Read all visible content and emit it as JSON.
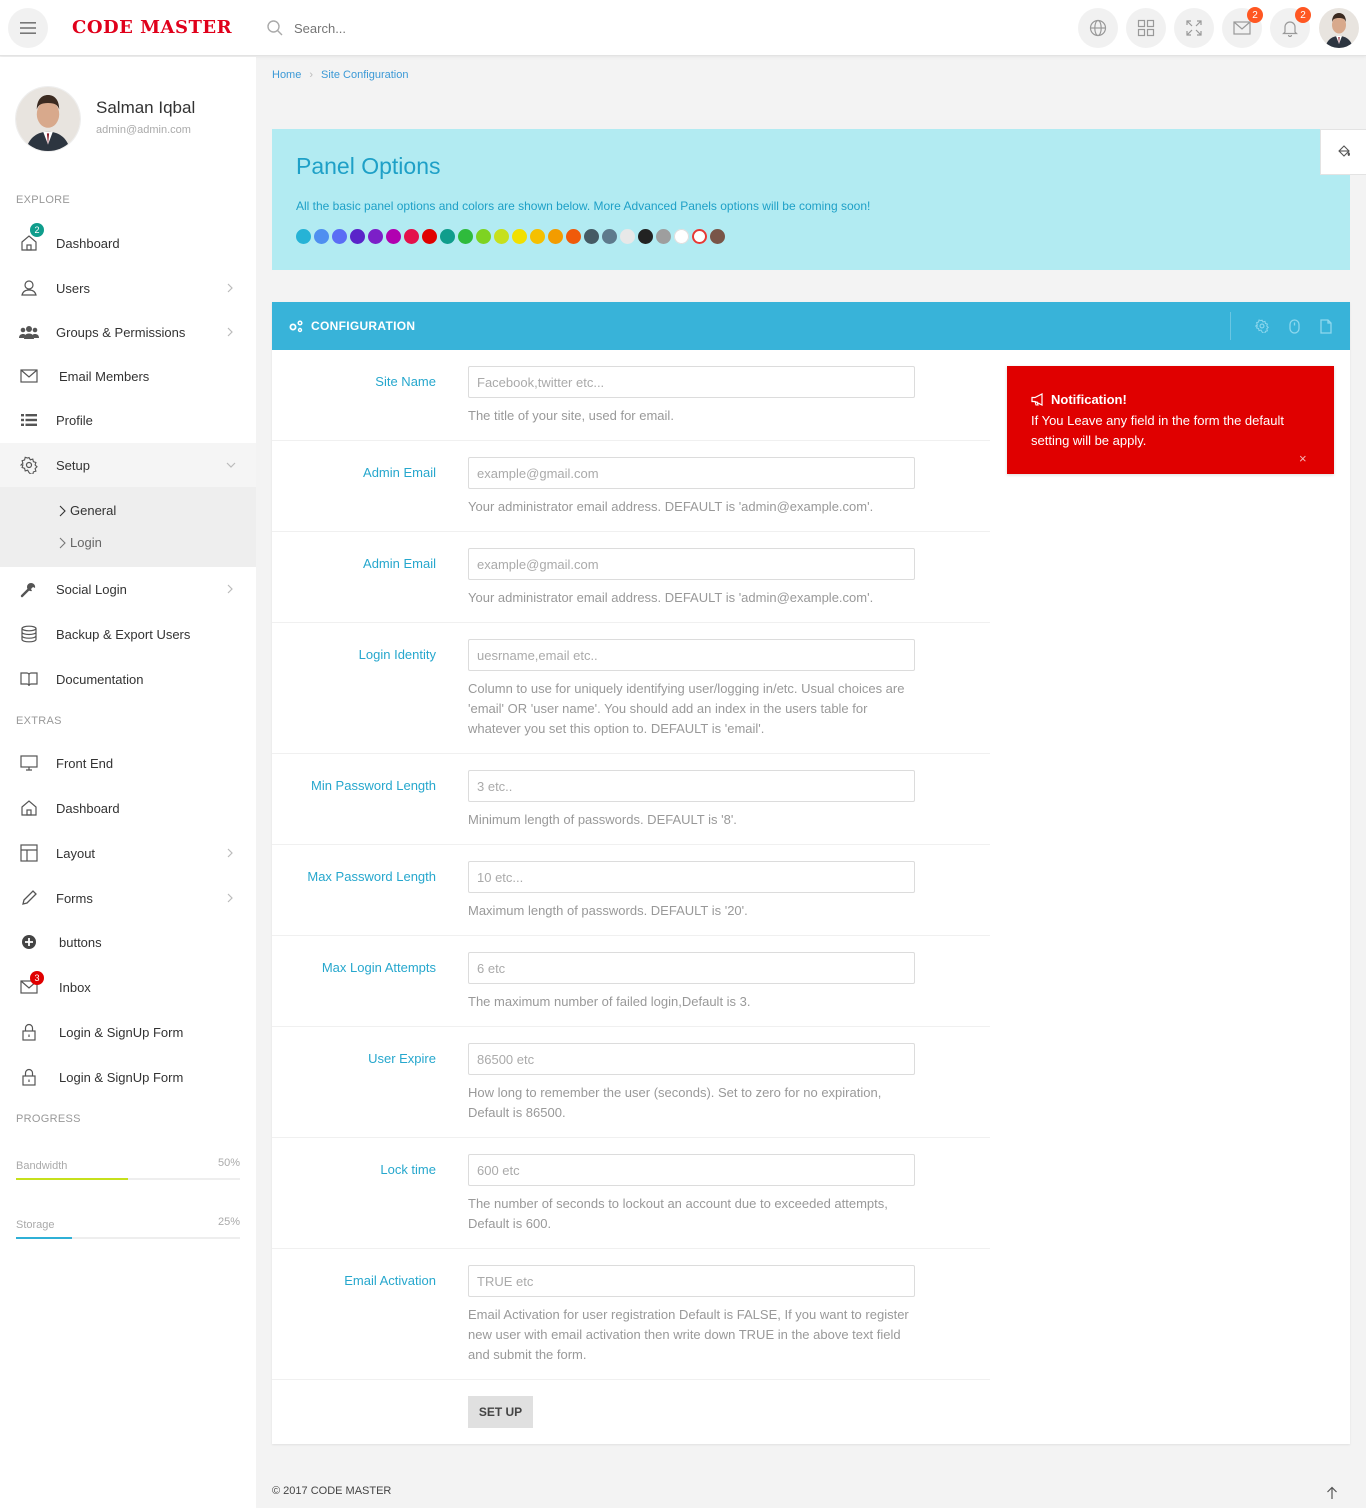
{
  "header": {
    "logo": "CODE MASTER",
    "search_placeholder": "Search...",
    "messages_count": "2",
    "notifications_count": "2"
  },
  "user": {
    "name": "Salman Iqbal",
    "email": "admin@admin.com"
  },
  "sidebar": {
    "explore_label": "EXPLORE",
    "extras_label": "EXTRAS",
    "progress_label": "PROGRESS",
    "items": {
      "dashboard": "Dashboard",
      "dashboard_badge": "2",
      "users": "Users",
      "groups": "Groups & Permissions",
      "email_members": "Email Members",
      "profile": "Profile",
      "setup": "Setup",
      "general": "General",
      "login": "Login",
      "social_login": "Social Login",
      "backup": "Backup & Export Users",
      "documentation": "Documentation",
      "front_end": "Front End",
      "dashboard2": "Dashboard",
      "layout": "Layout",
      "forms": "Forms",
      "buttons": "buttons",
      "inbox": "Inbox",
      "inbox_badge": "3",
      "login_signup_1": "Login & SignUp Form",
      "login_signup_2": "Login & SignUp Form"
    },
    "progress": {
      "bandwidth_label": "Bandwidth",
      "bandwidth_value": "50%",
      "bandwidth_fraction": 0.5,
      "bandwidth_color": "#c6e01c",
      "storage_label": "Storage",
      "storage_value": "25%",
      "storage_fraction": 0.25,
      "storage_color": "#2fb0d6"
    }
  },
  "breadcrumb": {
    "home": "Home",
    "current": "Site Configuration"
  },
  "panel_options": {
    "title": "Panel Options",
    "description": "All the basic panel options and colors are shown below. More Advanced Panels options will be coming soon!",
    "colors": [
      "#26b3d6",
      "#4f8ff0",
      "#5b6df5",
      "#5a24c9",
      "#7c1fc8",
      "#b100b0",
      "#e4114b",
      "#e00000",
      "#0f9d8c",
      "#2fbb3c",
      "#7ed321",
      "#c6e01c",
      "#f1e000",
      "#f5c000",
      "#f39c00",
      "#f05a0a",
      "#455a64",
      "#5e7a8c",
      "#e8e8e8",
      "#222222",
      "#9e9e9e",
      "#ffffff",
      "#ffffff",
      "#795548"
    ]
  },
  "config": {
    "title": "CONFIGURATION",
    "fields": [
      {
        "label": "Site Name",
        "placeholder": "Facebook,twitter etc...",
        "help": "The title of your site, used for email."
      },
      {
        "label": "Admin Email",
        "placeholder": "example@gmail.com",
        "help": "Your administrator email address. DEFAULT is 'admin@example.com'."
      },
      {
        "label": "Admin Email",
        "placeholder": "example@gmail.com",
        "help": "Your administrator email address. DEFAULT is 'admin@example.com'."
      },
      {
        "label": "Login Identity",
        "placeholder": "uesrname,email etc..",
        "help": "Column to use for uniquely identifying user/logging in/etc. Usual choices are 'email' OR 'user name'. You should add an index in the users table for whatever you set this option to. DEFAULT is 'email'."
      },
      {
        "label": "Min Password Length",
        "placeholder": "3 etc..",
        "help": "Minimum length of passwords. DEFAULT is '8'."
      },
      {
        "label": "Max Password Length",
        "placeholder": "10 etc...",
        "help": "Maximum length of passwords. DEFAULT is '20'."
      },
      {
        "label": "Max Login Attempts",
        "placeholder": "6 etc",
        "help": "The maximum number of failed login,Default is 3."
      },
      {
        "label": "User Expire",
        "placeholder": "86500 etc",
        "help": "How long to remember the user (seconds). Set to zero for no expiration, Default is 86500."
      },
      {
        "label": "Lock time",
        "placeholder": "600 etc",
        "help": "The number of seconds to lockout an account due to exceeded attempts, Default is 600."
      },
      {
        "label": "Email Activation",
        "placeholder": "TRUE etc",
        "help": "Email Activation for user registration Default is FALSE, If you want to register new user with email activation then write down TRUE in the above text field and submit the form."
      }
    ],
    "submit_label": "SET UP"
  },
  "notification": {
    "title": "Notification!",
    "body": "If You Leave any field in the form the default setting will be apply.",
    "close": "×"
  },
  "footer": {
    "copyright": "© 2017 CODE MASTER"
  }
}
